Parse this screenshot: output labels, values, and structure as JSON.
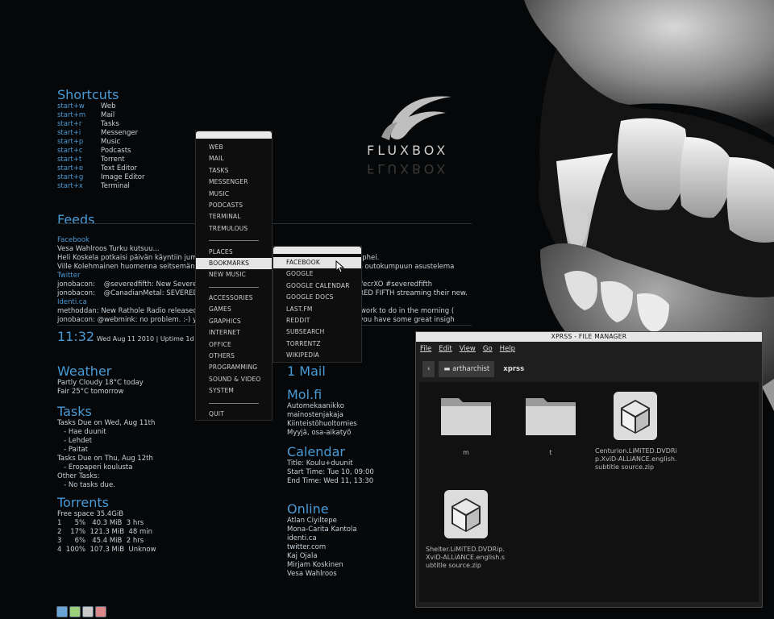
{
  "logo": {
    "text": "FLUXBOX"
  },
  "shortcuts": {
    "heading": "Shortcuts",
    "items": [
      {
        "key": "start+w",
        "label": "Web"
      },
      {
        "key": "start+m",
        "label": "Mail"
      },
      {
        "key": "start+r",
        "label": "Tasks"
      },
      {
        "key": "start+i",
        "label": "Messenger"
      },
      {
        "key": "start+p",
        "label": "Music"
      },
      {
        "key": "start+c",
        "label": "Podcasts"
      },
      {
        "key": "start+t",
        "label": "Torrent"
      },
      {
        "key": "start+e",
        "label": "Text Editor"
      },
      {
        "key": "start+g",
        "label": "Image Editor"
      },
      {
        "key": "start+x",
        "label": "Terminal"
      }
    ]
  },
  "feeds": {
    "heading": "Feeds",
    "lines": [
      {
        "text": "Facebook",
        "src": true
      },
      {
        "text": "Vesa Wahlroos Turku kutsuu...",
        "src": false
      },
      {
        "text": "Heli Koskela potkaisi päivän käyntiin jumalat                                                            illa. Hiphei.",
        "src": false
      },
      {
        "text": "Ville Kolehmainen huomenna seitsemän aik                                                            a eikun outokumpuun asustelema",
        "src": false
      },
      {
        "text": "Twitter",
        "src": true
      },
      {
        "text": "jonobacon:    @severedfifth: New Severed Fif                                                            /is.gd/ecrXO #severedfifth",
        "src": false
      },
      {
        "text": "jonobacon:    @CanadianMetal: SEVERED FIF                                                            SEVERED FIFTH streaming their new.",
        "src": false
      },
      {
        "text": "Identi.ca",
        "src": true
      },
      {
        "text": "methoddan: New Rathole Radio released li                                                            to bed, work to do in the morning (",
        "src": false
      },
      {
        "text": "jonobacon: @webmink: no problem. :-) you                                                            come, you have some great insigh",
        "src": false
      }
    ]
  },
  "clock": {
    "time": "11:32",
    "date": "Wed Aug 11 2010  |  Uptime 1d 15"
  },
  "weather": {
    "heading": "Weather",
    "lines": [
      "Partly Cloudy 18°C today",
      "Fair 25°C tomorrow"
    ]
  },
  "tasks": {
    "heading": "Tasks",
    "lines": [
      "Tasks Due on Wed, Aug 11th",
      "   - Hae duunit",
      "   - Lehdet",
      "   - Paitat",
      "Tasks Due on Thu, Aug 12th",
      "   - Eropaperi koulusta",
      "Other Tasks:",
      "   - No tasks due."
    ]
  },
  "torrents": {
    "heading": "Torrents",
    "lines": [
      "Free space 35.4GiB",
      "1      5%   40.3 MiB  3 hrs",
      "2    17%  121.3 MiB  48 min",
      "3      6%   45.4 MiB  2 hrs",
      "4  100%  107.3 MiB  Unknow"
    ]
  },
  "mail": {
    "heading": "1 Mail"
  },
  "molfi": {
    "heading": "Mol.fi",
    "lines": [
      "Automekaanikko",
      "mainostenjakaja",
      "Kiinteistöhuoltomies",
      "Myyjä, osa-aikatyö"
    ]
  },
  "calendar": {
    "heading": "Calendar",
    "lines": [
      "Title: Koulu+duunit",
      "Start Time: Tue 10, 09:00",
      "End Time: Wed 11, 13:30"
    ]
  },
  "online": {
    "heading": "Online",
    "lines": [
      "Atlan Ciyiltepe",
      "Mona-Carita Kantola",
      "identi.ca",
      "twitter.com",
      "Kaj Ojala",
      "Mirjam Koskinen",
      "Vesa Wahlroos"
    ]
  },
  "root_menu": {
    "items": [
      {
        "label": "WEB"
      },
      {
        "label": "MAIL"
      },
      {
        "label": "TASKS"
      },
      {
        "label": "MESSENGER"
      },
      {
        "label": "MUSIC"
      },
      {
        "label": "PODCASTS"
      },
      {
        "label": "TERMINAL"
      },
      {
        "label": "TREMULOUS"
      },
      {
        "sep": true
      },
      {
        "label": "PLACES"
      },
      {
        "label": "BOOKMARKS",
        "selected": true
      },
      {
        "label": "NEW MUSIC"
      },
      {
        "sep": true
      },
      {
        "label": "ACCESSORIES"
      },
      {
        "label": "GAMES"
      },
      {
        "label": "GRAPHICS"
      },
      {
        "label": "INTERNET"
      },
      {
        "label": "OFFICE"
      },
      {
        "label": "OTHERS"
      },
      {
        "label": "PROGRAMMING"
      },
      {
        "label": "SOUND & VIDEO"
      },
      {
        "label": "SYSTEM"
      },
      {
        "sep": true
      },
      {
        "label": "QUIT"
      }
    ]
  },
  "bookmarks_menu": {
    "items": [
      {
        "label": "FACEBOOK",
        "selected": true
      },
      {
        "label": "GOOGLE"
      },
      {
        "label": "GOOGLE CALENDAR"
      },
      {
        "label": "GOOGLE DOCS"
      },
      {
        "label": "LAST.FM"
      },
      {
        "label": "REDDIT"
      },
      {
        "label": "SUBSEARCH"
      },
      {
        "label": "TORRENTZ"
      },
      {
        "label": "WIKIPEDIA"
      }
    ]
  },
  "file_manager": {
    "title": "XPRSS - FILE MANAGER",
    "menu": [
      "File",
      "Edit",
      "View",
      "Go",
      "Help"
    ],
    "path": [
      "artharchist",
      "xprss"
    ],
    "files": [
      {
        "name": "m",
        "kind": "folder"
      },
      {
        "name": "t",
        "kind": "folder"
      },
      {
        "name": "Centurion.LiMiTED.DVDRip.XviD-ALLiANCE.english.subtitle source.zip",
        "kind": "package"
      },
      {
        "name": "Shelter.LiMiTED.DVDRip.XviD-ALLiANCE.english.subtitle source.zip",
        "kind": "package"
      }
    ]
  },
  "colors": {
    "accent": "#4a9ad6",
    "menu_bg": "#0e0e0f",
    "selected": "#e4e4e4"
  }
}
